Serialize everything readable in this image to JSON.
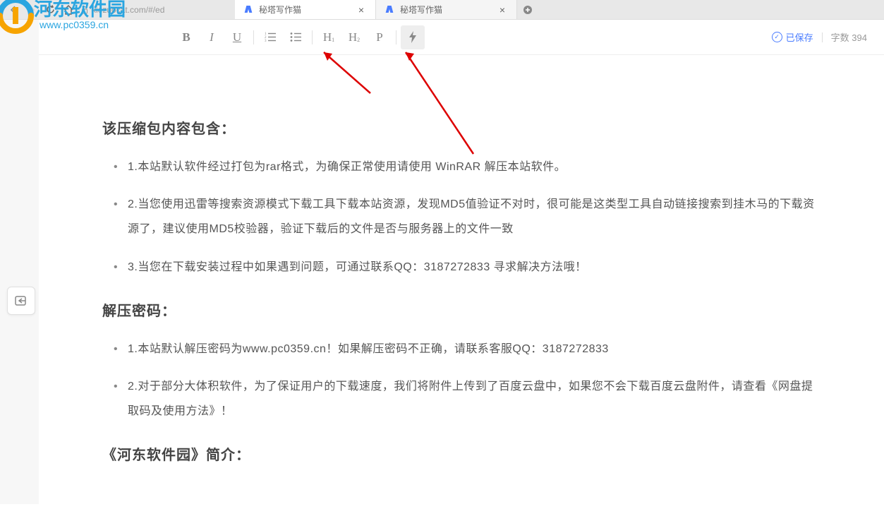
{
  "browser": {
    "url": "xiezuocat.com/#/ed",
    "tabs": [
      {
        "title": "秘塔写作猫",
        "active": true
      },
      {
        "title": "秘塔写作猫",
        "active": false
      }
    ]
  },
  "toolbar": {
    "buttons": {
      "bold": "B",
      "italic": "I",
      "underline": "U",
      "h1_main": "H",
      "h1_sub": "1",
      "h2_main": "H",
      "h2_sub": "2",
      "paragraph": "P"
    },
    "saved_label": "已保存",
    "word_count_label": "字数",
    "word_count_value": "394"
  },
  "content": {
    "heading1": "该压缩包内容包含：",
    "list1": [
      "1.本站默认软件经过打包为rar格式，为确保正常使用请使用 WinRAR 解压本站软件。",
      "2.当您使用迅雷等搜索资源模式下载工具下载本站资源，发现MD5值验证不对时，很可能是这类型工具自动链接搜索到挂木马的下载资源了，建议使用MD5校验器，验证下载后的文件是否与服务器上的文件一致",
      "3.当您在下载安装过程中如果遇到问题，可通过联系QQ：3187272833 寻求解决方法哦！"
    ],
    "heading2": "解压密码：",
    "list2": [
      "1.本站默认解压密码为www.pc0359.cn！如果解压密码不正确，请联系客服QQ：3187272833",
      "2.对于部分大体积软件，为了保证用户的下载速度，我们将附件上传到了百度云盘中，如果您不会下载百度云盘附件，请查看《网盘提取码及使用方法》！"
    ],
    "heading3": "《河东软件园》简介："
  },
  "watermark": {
    "text_cn": "河东软件园",
    "text_url": "www.pc0359.cn"
  }
}
